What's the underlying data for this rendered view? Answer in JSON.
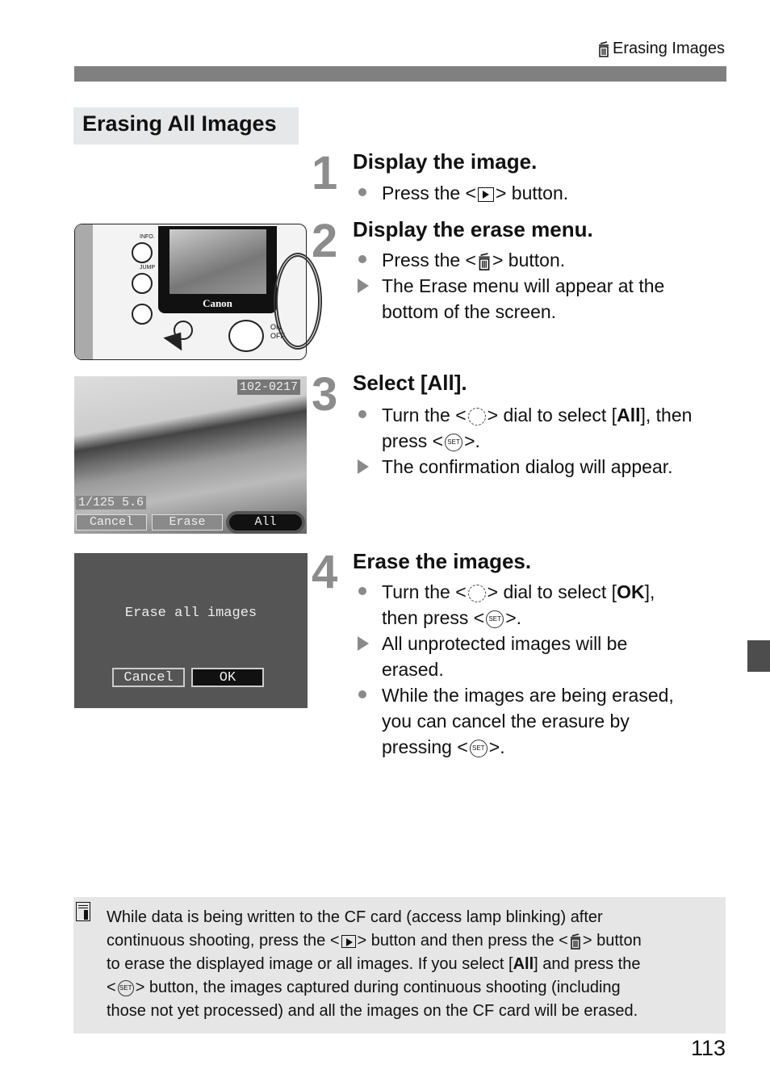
{
  "header": {
    "icon": "trash-icon",
    "title": "Erasing Images"
  },
  "section_title": "Erasing All Images",
  "steps": [
    {
      "number": "1",
      "heading": "Display the image.",
      "lines": [
        {
          "type": "bullet",
          "parts": [
            "Press the <",
            "playback-icon",
            "> button."
          ]
        }
      ]
    },
    {
      "number": "2",
      "heading": "Display the erase menu.",
      "lines": [
        {
          "type": "bullet",
          "parts": [
            "Press the <",
            "trash-icon",
            "> button."
          ]
        },
        {
          "type": "result",
          "text_1": "The Erase menu will appear at the",
          "text_2": "bottom of the screen."
        }
      ]
    },
    {
      "number": "3",
      "heading": "Select [All].",
      "lines": [
        {
          "type": "bullet",
          "pre": "Turn the <",
          "post": "> dial to select [",
          "bold": "All",
          "end": "], then",
          "line2_pre": "press <",
          "line2_post": ">."
        },
        {
          "type": "result",
          "text": "The confirmation dialog will appear."
        }
      ]
    },
    {
      "number": "4",
      "heading": "Erase the images.",
      "lines": [
        {
          "type": "bullet",
          "pre": "Turn the <",
          "post": "> dial to select [",
          "bold": "OK",
          "end": "],",
          "line2_pre": "then press <",
          "line2_post": ">."
        },
        {
          "type": "result",
          "text_1": "All unprotected images will be",
          "text_2": "erased."
        },
        {
          "type": "bullet",
          "text_1": "While the images are being erased,",
          "text_2": "you can cancel the erasure by",
          "line3_pre": "pressing <",
          "line3_post": ">."
        }
      ]
    }
  ],
  "icons": {
    "set_label": "SET"
  },
  "camera_illustration": {
    "labels": [
      "INFO.",
      "JUMP"
    ],
    "brand": "Canon",
    "switch_on": "ON",
    "switch_off": "OFF"
  },
  "lcd_erase_menu": {
    "file_number": "102-0217",
    "exposure": "1/125  5.6",
    "buttons": [
      "Cancel",
      "Erase",
      "All"
    ],
    "selected": "All"
  },
  "lcd_confirm_dialog": {
    "message": "Erase all images",
    "buttons": [
      "Cancel",
      "OK"
    ],
    "selected": "OK"
  },
  "note": {
    "icon": "memo-icon",
    "line1": "While data is being written to the CF card (access lamp blinking) after",
    "line2_pre": "continuous shooting, press the <",
    "line2_mid": "> button and then press the <",
    "line2_post": "> button",
    "line3_pre": "to erase the displayed image or all images. If you select [",
    "line3_bold": "All",
    "line3_post": "] and press the",
    "line4_pre": "<",
    "line4_post": "> button, the images captured during continuous shooting (including",
    "line5": "those not yet processed) and all the images on the CF card will be erased."
  },
  "page_number": "113",
  "colors": {
    "header_bar": "#808080",
    "section_bg": "#e6e7e9",
    "step_number": "#8c8c8c",
    "note_bg": "#e6e6e6",
    "side_tab": "#4d4d4d"
  }
}
